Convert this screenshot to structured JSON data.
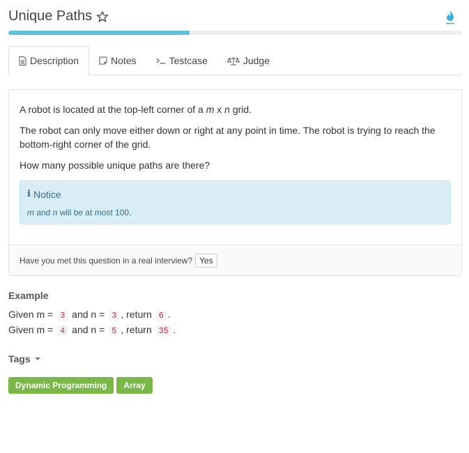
{
  "header": {
    "title": "Unique Paths",
    "favorite_icon": "star-outline-icon",
    "flame_icon": "flame-icon",
    "accent_color": "#5bc0de"
  },
  "progress": {
    "fraction": 0.4
  },
  "tabs": [
    {
      "label": "Description",
      "icon": "document-icon",
      "active": true
    },
    {
      "label": "Notes",
      "icon": "note-icon",
      "active": false
    },
    {
      "label": "Testcase",
      "icon": "terminal-icon",
      "active": false
    },
    {
      "label": "Judge",
      "icon": "scale-icon",
      "active": false
    }
  ],
  "description": {
    "p1_before": "A robot is located at the top-left corner of a ",
    "p1_m": "m",
    "p1_x": " x ",
    "p1_n": "n",
    "p1_after": " grid.",
    "p2": "The robot can only move either down or right at any point in time. The robot is trying to reach the bottom-right corner of the grid.",
    "p3": "How many possible unique paths are there?"
  },
  "notice": {
    "title": "Notice",
    "m": "m",
    "and": " and ",
    "n": "n",
    "rest": " will be at most 100.",
    "icon": "info-icon"
  },
  "footer": {
    "question": "Have you met this question in a real interview?",
    "yes_label": "Yes"
  },
  "example": {
    "heading": "Example",
    "lines": [
      {
        "given_m": "Given m = ",
        "m": "3",
        "and_n": " and n = ",
        "n": "3",
        "ret": ", return ",
        "result": "6",
        "end": "."
      },
      {
        "given_m": "Given m = ",
        "m": "4",
        "and_n": " and n = ",
        "n": "5",
        "ret": ", return ",
        "result": "35",
        "end": "."
      }
    ]
  },
  "tags": {
    "label": "Tags",
    "items": [
      "Dynamic Programming",
      "Array"
    ],
    "color": "#7ab648"
  }
}
